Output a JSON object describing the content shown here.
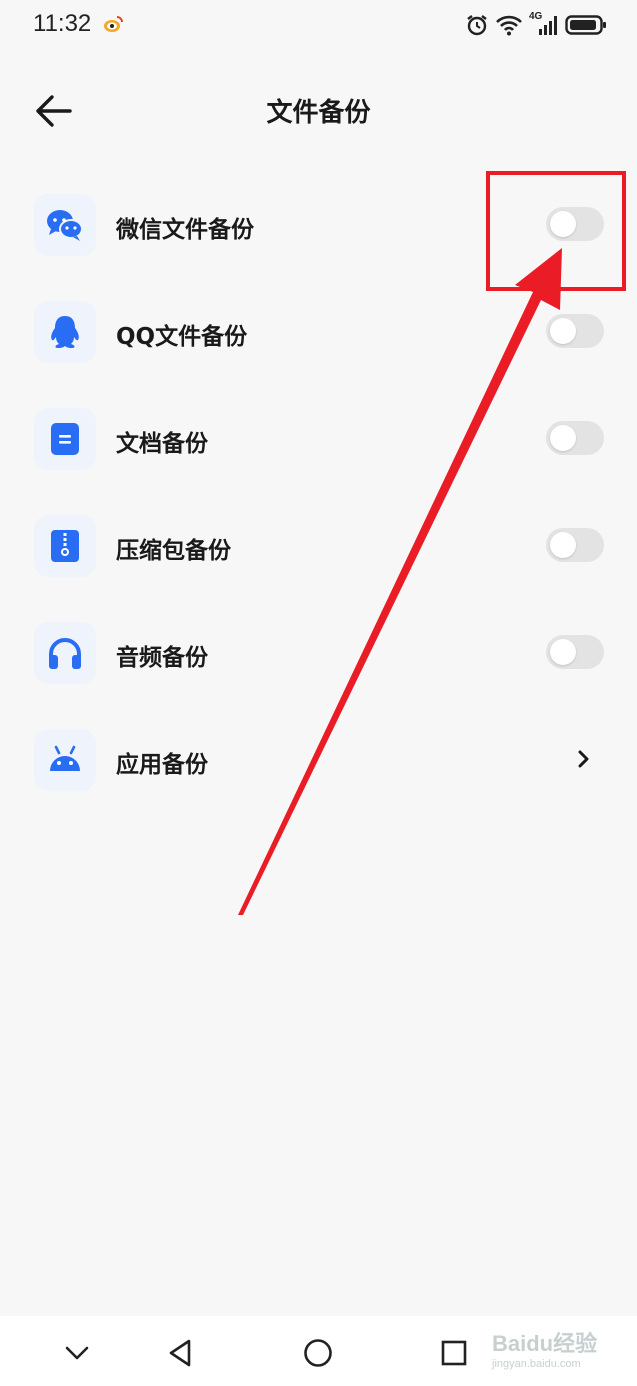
{
  "status_bar": {
    "time": "11:32",
    "network": "4G"
  },
  "header": {
    "title": "文件备份"
  },
  "items": [
    {
      "label": "微信文件备份",
      "icon": "wechat-icon",
      "control": "toggle",
      "enabled": false
    },
    {
      "label": "QQ文件备份",
      "icon": "qq-icon",
      "control": "toggle",
      "enabled": false
    },
    {
      "label": "文档备份",
      "icon": "document-icon",
      "control": "toggle",
      "enabled": false
    },
    {
      "label": "压缩包备份",
      "icon": "archive-icon",
      "control": "toggle",
      "enabled": false
    },
    {
      "label": "音频备份",
      "icon": "headphones-icon",
      "control": "toggle",
      "enabled": false
    },
    {
      "label": "应用备份",
      "icon": "android-icon",
      "control": "chevron"
    }
  ],
  "colors": {
    "accent": "#2a6df5",
    "toggle_off": "#e3e3e3",
    "annotation": "#ea1c26",
    "background": "#f7f7f7"
  },
  "watermark": {
    "text": "Baidu经验",
    "sub": "jingyan.baidu.com"
  }
}
